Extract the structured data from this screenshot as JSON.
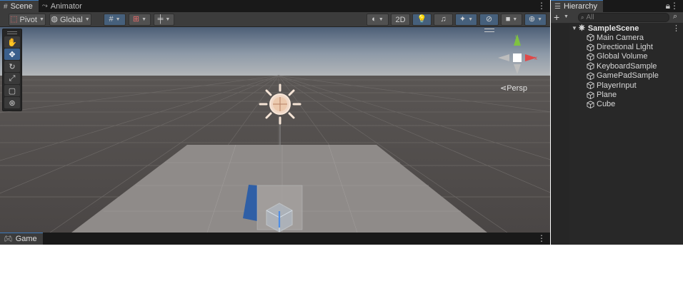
{
  "scene_panel": {
    "tabs": [
      {
        "label": "Scene",
        "icon": "grid-icon",
        "active": true
      },
      {
        "label": "Animator",
        "icon": "animator-icon",
        "active": false
      }
    ],
    "toolbar": {
      "pivot_label": "Pivot",
      "global_label": "Global",
      "mode_2d_label": "2D"
    },
    "tools": [
      "hand-tool",
      "move-tool",
      "rotate-tool",
      "scale-tool",
      "rect-tool",
      "transform-tool"
    ],
    "active_tool": "move-tool",
    "view_label": "Persp",
    "gizmo_axes": {
      "y": "y",
      "x": "x"
    }
  },
  "game_panel": {
    "tabs": [
      {
        "label": "Game",
        "icon": "gamepad-icon"
      }
    ]
  },
  "hierarchy": {
    "tab_label": "Hierarchy",
    "search_placeholder": "All",
    "scene_name": "SampleScene",
    "items": [
      "Main Camera",
      "Directional Light",
      "Global Volume",
      "KeyboardSample",
      "GamePadSample",
      "PlayerInput",
      "Plane",
      "Cube"
    ]
  },
  "colors": {
    "accent": "#3a79bb",
    "panel_bg": "#282828",
    "toolbar_bg": "#3c3c3c",
    "gizmo_x": "#e04848",
    "gizmo_y": "#7fc241",
    "cube_selected": "#2f5fa6"
  }
}
